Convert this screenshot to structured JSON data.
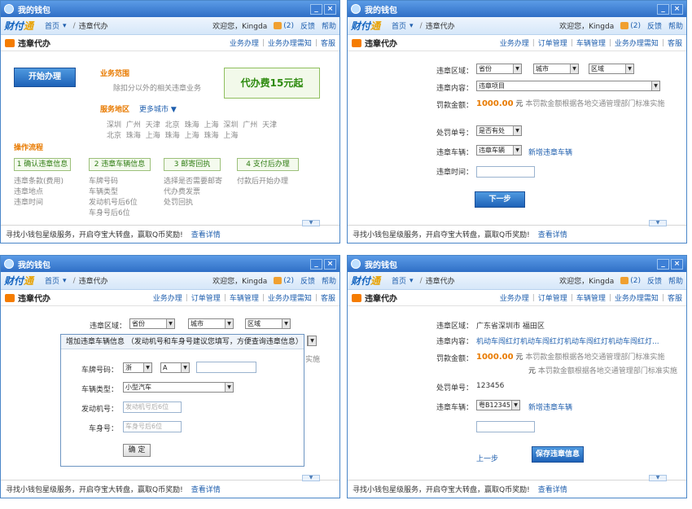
{
  "common": {
    "window_title": "我的钱包",
    "logo_text_a": "财付",
    "logo_text_b": "通",
    "nav_home": "首页",
    "nav_current": "违章代办",
    "welcome": "欢迎您，Kingda",
    "msg_count": "(2)",
    "feedback": "反馈",
    "help": "帮助",
    "section_title": "违章代办",
    "footer_text": "寻找小钱包星级服务，开启夺宝大转盘，赢取Q币奖励!",
    "footer_link": "查看详情",
    "tab_sep": "|",
    "nav_sep": "/",
    "nav_dropdown_mark": "▾",
    "win_min": "_",
    "win_close": "×",
    "collapse_mark": "▼"
  },
  "panel1": {
    "tabs": [
      "业务办理",
      "业务办理需知",
      "客服"
    ],
    "start_button": "开始办理",
    "scope_title": "业务范围",
    "scope_desc": "除扣分以外的相关违章业务",
    "promo": "代办费15元起",
    "area_title": "服务地区",
    "more_cities": "更多城市",
    "cities_line1": [
      "深圳",
      "广州",
      "天津",
      "北京",
      "珠海",
      "上海",
      "深圳",
      "广州",
      "天津"
    ],
    "cities_line2": [
      "北京",
      "珠海",
      "上海",
      "珠海",
      "上海",
      "珠海",
      "上海"
    ],
    "process_title": "操作流程",
    "steps": [
      {
        "label": "1  确认违章信息",
        "details": [
          "违章条款(费用)",
          "违章地点",
          "违章时间"
        ]
      },
      {
        "label": "2 违章车辆信息",
        "details": [
          "车牌号码",
          "车辆类型",
          "发动机号后6位",
          "车身号后6位"
        ]
      },
      {
        "label": "3 邮寄回执",
        "details": [
          "选择是否需要邮寄",
          "代办费发票",
          "处罚回执"
        ]
      },
      {
        "label": "4 支付后办理",
        "details": [
          "付款后开始办理"
        ]
      }
    ]
  },
  "panel2": {
    "tabs": [
      "业务办理",
      "订单管理",
      "车辆管理",
      "业务办理需知",
      "客服"
    ],
    "area_label": "违章区域：",
    "province": "省份",
    "city": "城市",
    "district": "区域",
    "content_label": "违章内容：",
    "content_value": "违章项目",
    "fine_label": "罚款金额：",
    "fine_value": "1000.00",
    "fine_unit": "元",
    "fine_note": "本罚款金额根据各地交通管理部门标准实施",
    "ticket_label": "处罚单号：",
    "ticket_value": "是否有处",
    "vehicle_label": "违章车辆：",
    "vehicle_value": "违章车辆",
    "add_vehicle": "新增违章车辆",
    "time_label": "违章时间：",
    "next_button": "下一步"
  },
  "panel3": {
    "tabs": [
      "业务办理",
      "订单管理",
      "车辆管理",
      "业务办理需知",
      "客服"
    ],
    "area_label": "违章区域：",
    "province": "省份",
    "city": "城市",
    "district": "区域",
    "hidden_text": "实施",
    "dialog_title": "增加违章车辆信息 （发动机号和车身号建议您填写，方便查询违章信息）",
    "dialog_close": "×",
    "plate_label": "车牌号码：",
    "plate_province": "浙",
    "plate_letter": "A",
    "type_label": "车辆类型：",
    "type_value": "小型汽车",
    "engine_label": "发动机号：",
    "engine_placeholder": "发动机号后6位",
    "body_label": "车身号：",
    "body_placeholder": "车身号后6位",
    "ok_button": "确 定"
  },
  "panel4": {
    "tabs": [
      "业务办理",
      "订单管理",
      "车辆管理",
      "业务办理需知",
      "客服"
    ],
    "area_label": "违章区域：",
    "area_value": "广东省深圳市 福田区",
    "content_label": "违章内容：",
    "content_value": "机动车闯红灯机动车闯红灯机动车闯红灯机动车闯红灯...",
    "fine_label": "罚款金额：",
    "fine_value": "1000.00",
    "fine_unit": "元",
    "fine_note": "本罚款金额根据各地交通管理部门标准实施",
    "fine_unit2": "元",
    "fine_note2": "本罚款金额根据各地交通管理部门标准实施",
    "ticket_label": "处罚单号：",
    "ticket_value": "123456",
    "vehicle_label": "违章车辆：",
    "vehicle_value": "粤B12345",
    "add_vehicle": "新增违章车辆",
    "prev_link": "上一步",
    "save_button": "保存违章信息"
  }
}
